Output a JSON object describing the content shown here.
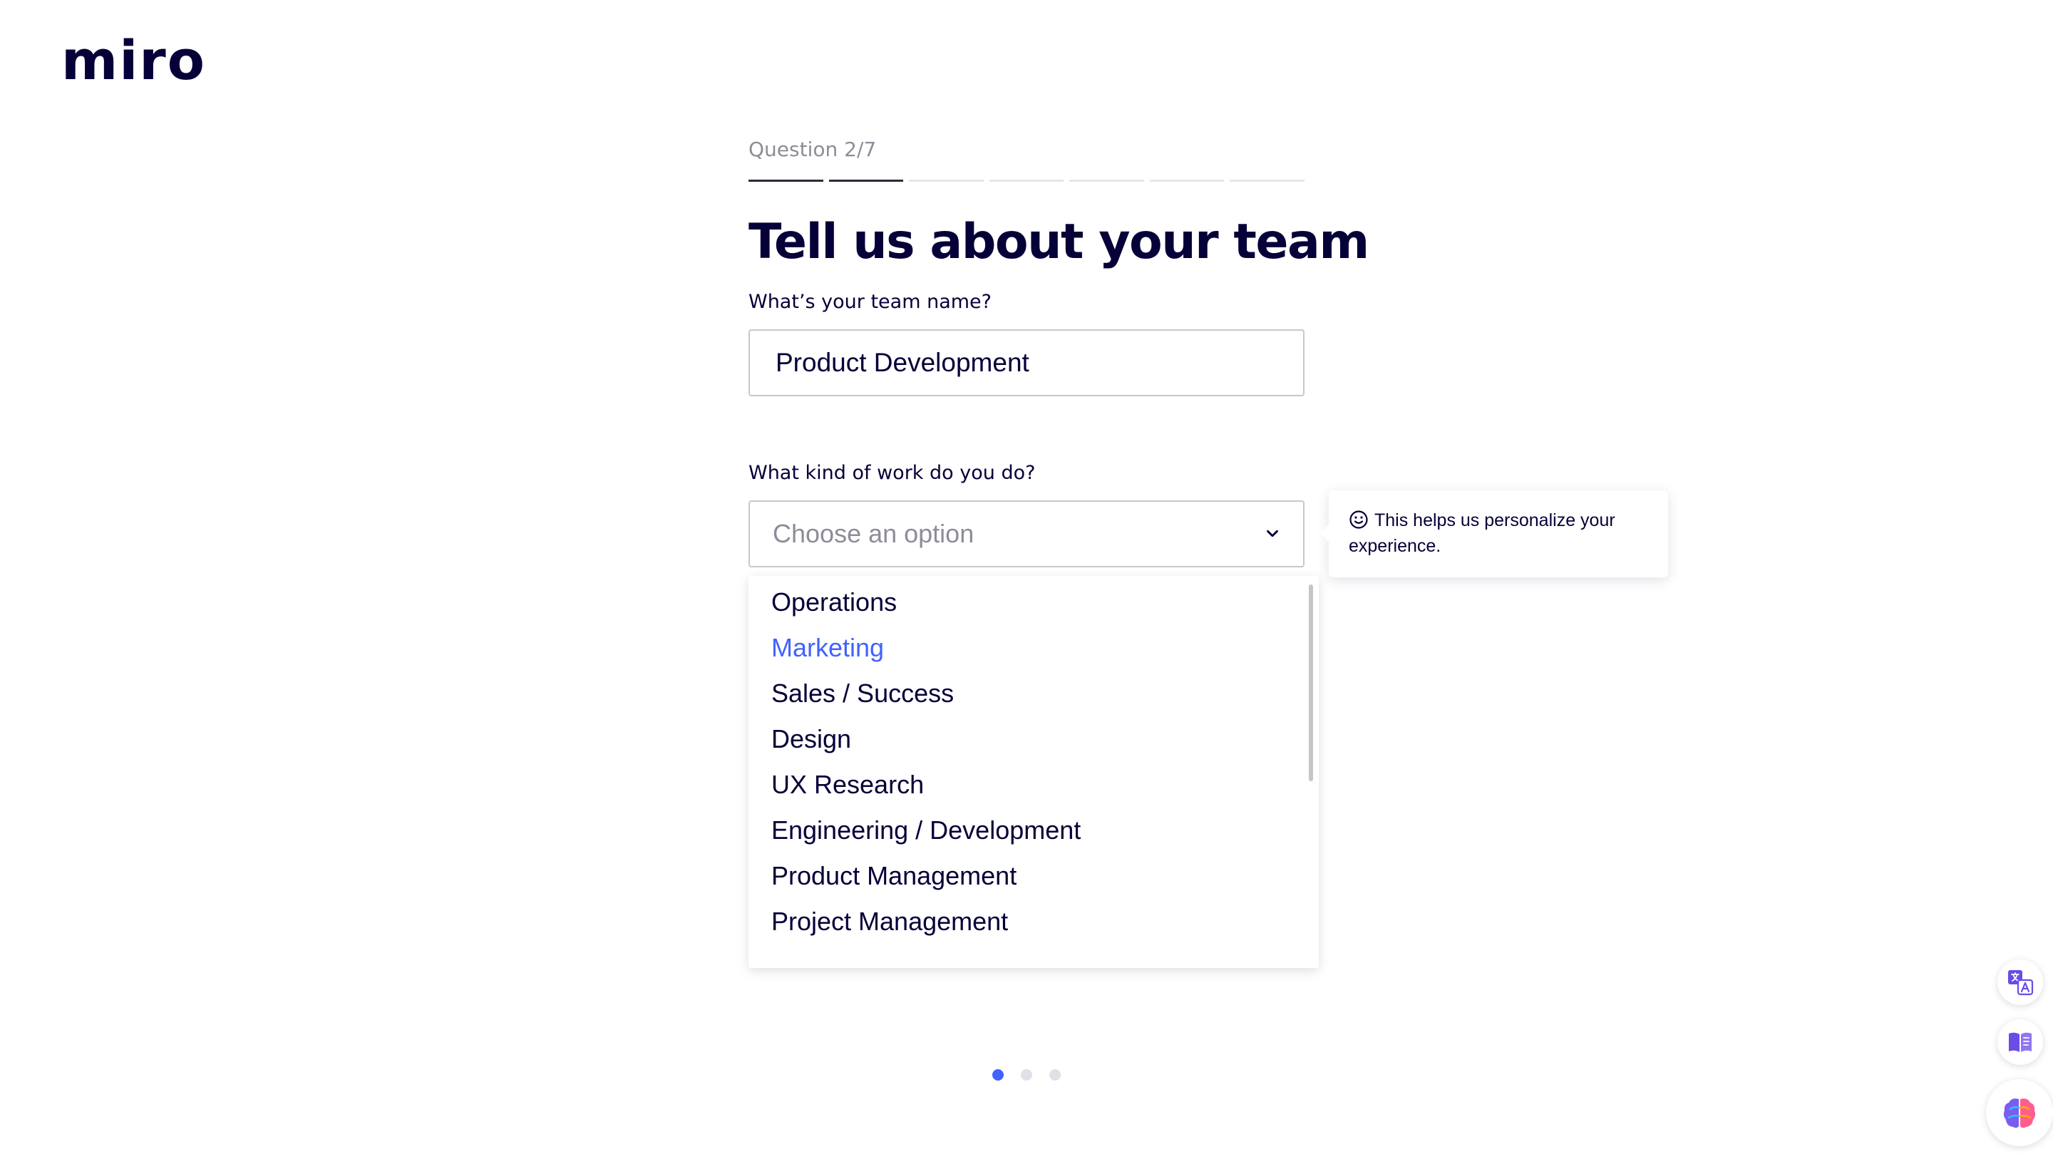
{
  "brand": {
    "logo_text": "miro"
  },
  "question": {
    "progress_label": "Question 2/7",
    "current": 2,
    "total": 7,
    "title": "Tell us about your team"
  },
  "team_name": {
    "label": "What’s your team name?",
    "value": "Product Development"
  },
  "work_kind": {
    "label": "What kind of work do you do?",
    "placeholder": "Choose an option",
    "highlighted_option": "Marketing",
    "options": [
      "Operations",
      "Marketing",
      "Sales / Success",
      "Design",
      "UX Research",
      "Engineering / Development",
      "Product Management",
      "Project Management"
    ]
  },
  "tooltip": {
    "text": "This helps us personalize your experience."
  },
  "pagination": {
    "pages": 3,
    "active": 1
  },
  "colors": {
    "primary_text": "#050038",
    "accent": "#4262ff",
    "muted": "#8e8c99"
  },
  "side_icons": [
    "translate-icon",
    "book-icon",
    "brain-icon"
  ]
}
